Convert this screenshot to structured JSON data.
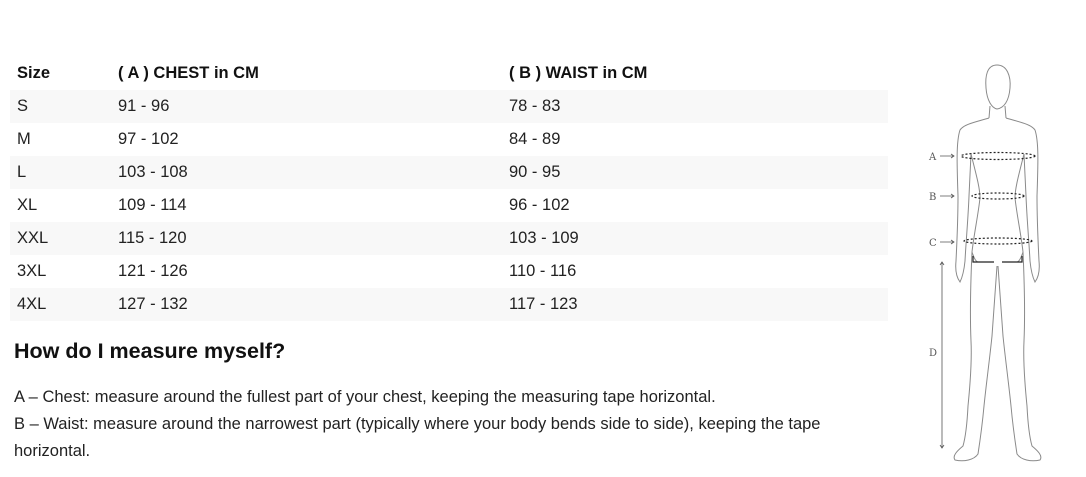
{
  "table": {
    "headers": [
      "Size",
      "( A ) CHEST in CM",
      "( B ) WAIST in CM"
    ],
    "rows": [
      {
        "size": "S",
        "chest": "91 - 96",
        "waist": "78 - 83"
      },
      {
        "size": "M",
        "chest": "97 - 102",
        "waist": "84 - 89"
      },
      {
        "size": "L",
        "chest": "103 - 108",
        "waist": "90 - 95"
      },
      {
        "size": "XL",
        "chest": "109 - 114",
        "waist": "96 - 102"
      },
      {
        "size": "XXL",
        "chest": "115 - 120",
        "waist": "103 - 109"
      },
      {
        "size": "3XL",
        "chest": "121 - 126",
        "waist": "110 - 116"
      },
      {
        "size": "4XL",
        "chest": "127 - 132",
        "waist": "117 - 123"
      }
    ]
  },
  "guide": {
    "heading": "How do I measure myself?",
    "instructions": [
      "A – Chest: measure around the fullest part of your chest, keeping the measuring tape horizontal.",
      "B – Waist: measure around the narrowest part (typically where your body bends side to side), keeping the tape horizontal."
    ]
  },
  "figure": {
    "labels": {
      "a": "A",
      "b": "B",
      "c": "C",
      "d": "D"
    }
  }
}
